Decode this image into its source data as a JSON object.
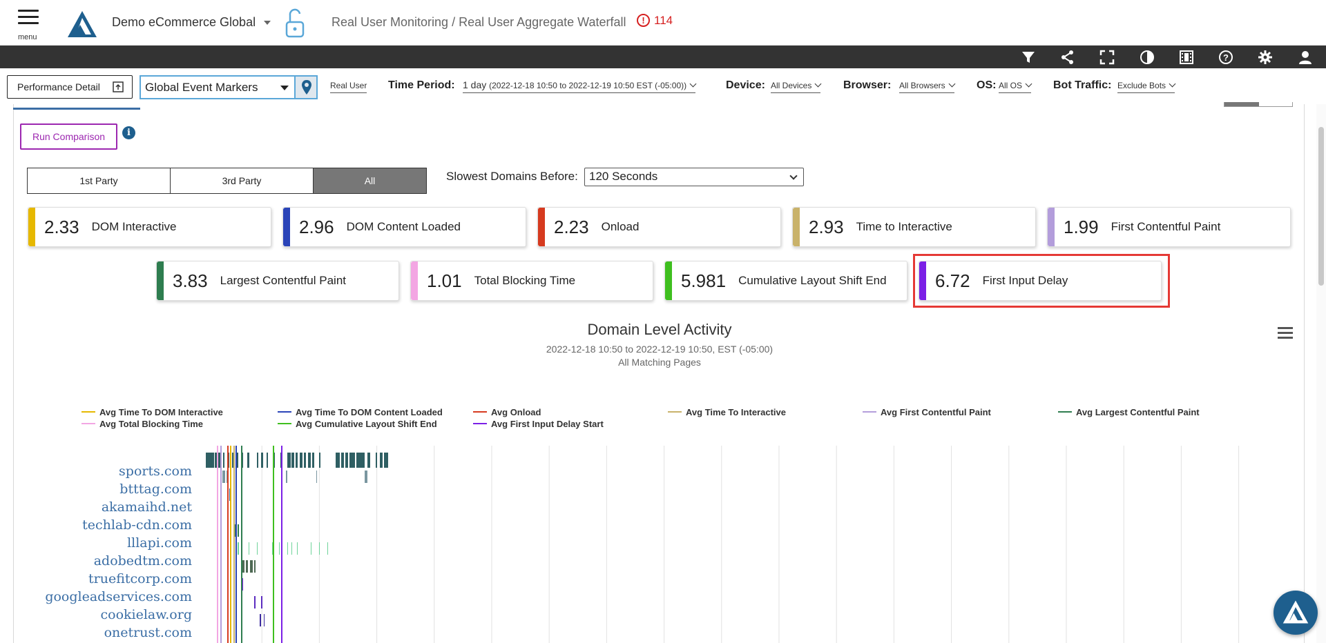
{
  "header": {
    "menu_label": "menu",
    "app_title": "Demo eCommerce Global",
    "breadcrumb": "Real User Monitoring / Real User Aggregate Waterfall",
    "alert_count": "114"
  },
  "toolbar_icons": [
    "filter-icon",
    "share-icon",
    "fullscreen-icon",
    "contrast-icon",
    "film-icon",
    "help-icon",
    "settings-icon",
    "user-icon"
  ],
  "filters": {
    "performance_detail": "Performance Detail",
    "event_markers": "Global Event Markers",
    "data_source": "Real User",
    "time_period_label": "Time Period:",
    "time_period_value": "1 day",
    "time_period_range": "(2022-12-18 10:50 to 2022-12-19 10:50 EST (-05:00))",
    "device_label": "Device:",
    "device_value": "All Devices",
    "browser_label": "Browser:",
    "browser_value": "All Browsers",
    "os_label": "OS:",
    "os_value": "All OS",
    "bot_label": "Bot Traffic:",
    "bot_value": "Exclude Bots"
  },
  "controls": {
    "run_comparison": "Run Comparison",
    "info": "i",
    "party_tabs": [
      "1st Party",
      "3rd Party",
      "All"
    ],
    "active_party": "All",
    "slowest_label": "Slowest Domains Before:",
    "slowest_value": "120 Seconds"
  },
  "metrics_row1": [
    {
      "value": "2.33",
      "label": "DOM Interactive",
      "color": "#e6b800"
    },
    {
      "value": "2.96",
      "label": "DOM Content Loaded",
      "color": "#2a44b8"
    },
    {
      "value": "2.23",
      "label": "Onload",
      "color": "#d63a1f"
    },
    {
      "value": "2.93",
      "label": "Time to Interactive",
      "color": "#c9b26a"
    },
    {
      "value": "1.99",
      "label": "First Contentful Paint",
      "color": "#b39ddb"
    }
  ],
  "metrics_row2": [
    {
      "value": "3.83",
      "label": "Largest Contentful Paint",
      "color": "#2e7d4f"
    },
    {
      "value": "1.01",
      "label": "Total Blocking Time",
      "color": "#f3a6e3"
    },
    {
      "value": "5.981",
      "label": "Cumulative Layout Shift End",
      "color": "#3fbf1f"
    },
    {
      "value": "6.72",
      "label": "First Input Delay",
      "color": "#7b1fe6"
    }
  ],
  "chart": {
    "title": "Domain Level Activity",
    "subtitle": "2022-12-18 10:50 to 2022-12-19 10:50, EST (-05:00)",
    "subtitle2": "All Matching Pages",
    "legend": [
      {
        "name": "Avg Time To DOM Interactive",
        "color": "#e6b800"
      },
      {
        "name": "Avg Time To DOM Content Loaded",
        "color": "#2a44b8"
      },
      {
        "name": "Avg Onload",
        "color": "#d63a1f"
      },
      {
        "name": "Avg Time To Interactive",
        "color": "#c9b26a"
      },
      {
        "name": "Avg First Contentful Paint",
        "color": "#b39ddb"
      },
      {
        "name": "Avg Largest Contentful Paint",
        "color": "#2e7d4f"
      },
      {
        "name": "Avg Total Blocking Time",
        "color": "#f3a6e3"
      },
      {
        "name": "Avg Cumulative Layout Shift End",
        "color": "#3fbf1f"
      },
      {
        "name": "Avg First Input Delay Start",
        "color": "#7b1fe6"
      }
    ],
    "domains": [
      "sports.com",
      "btttag.com",
      "akamaihd.net",
      "techlab-cdn.com",
      "lllapi.com",
      "adobedtm.com",
      "truefitcorp.com",
      "googleadservices.com",
      "cookielaw.org",
      "onetrust.com"
    ]
  }
}
